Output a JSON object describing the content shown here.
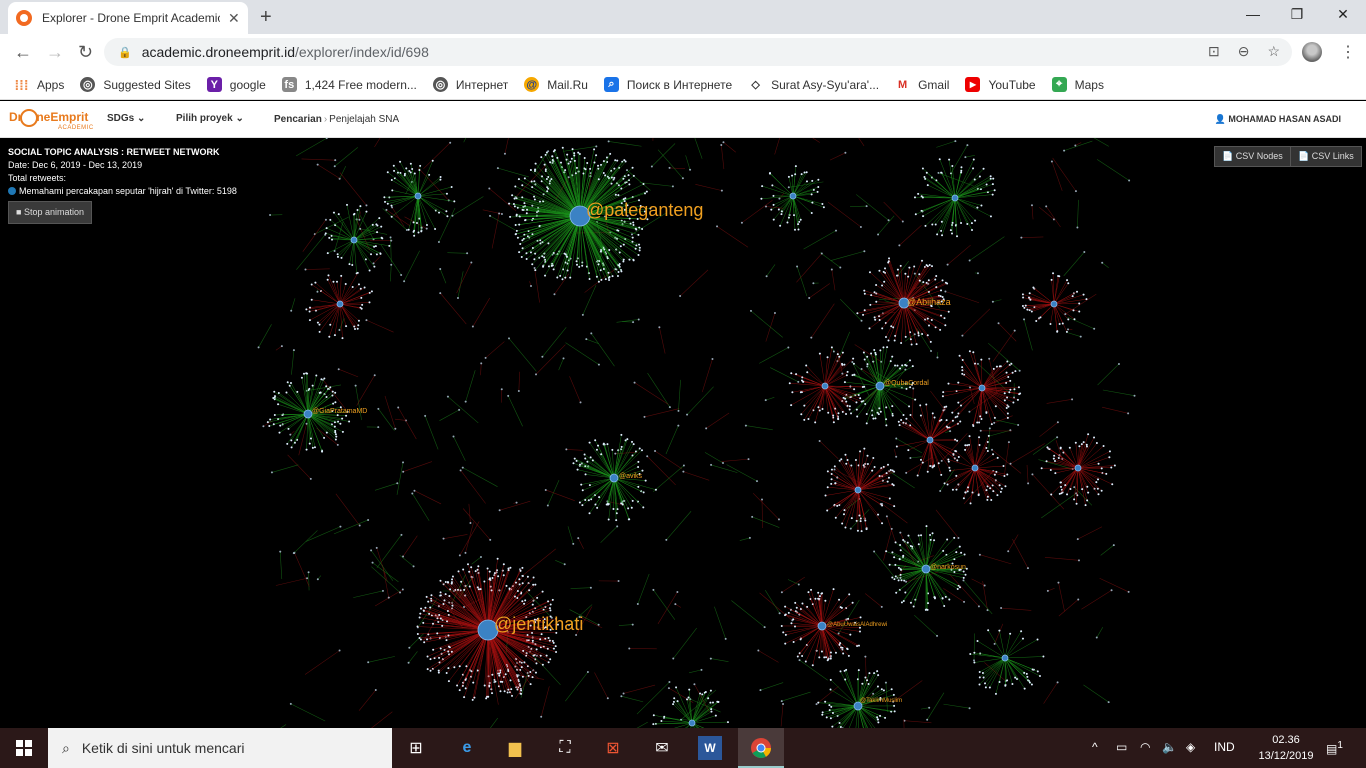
{
  "browser": {
    "tab_title": "Explorer - Drone Emprit Academic",
    "url_host": "academic.droneemprit.id",
    "url_path": "/explorer/index/id/698"
  },
  "bookmarks": [
    {
      "label": "Apps",
      "icon": "apps-grid-icon"
    },
    {
      "label": "Suggested Sites",
      "icon": "globe-icon"
    },
    {
      "label": "google",
      "icon": "yahoo-icon"
    },
    {
      "label": "1,424 Free modern...",
      "icon": "fs-icon"
    },
    {
      "label": "Интернет",
      "icon": "globe-icon"
    },
    {
      "label": "Mail.Ru",
      "icon": "mailru-icon"
    },
    {
      "label": "Поиск в Интернете",
      "icon": "search-icon"
    },
    {
      "label": "Surat Asy-Syu'ara'...",
      "icon": "globe-icon"
    },
    {
      "label": "Gmail",
      "icon": "gmail-icon"
    },
    {
      "label": "YouTube",
      "icon": "youtube-icon"
    },
    {
      "label": "Maps",
      "icon": "maps-icon"
    }
  ],
  "appnav": {
    "logo_text": "DroneEmprit",
    "logo_sub": "ACADEMIC",
    "menu_sdgs": "SDGs",
    "menu_project": "Pilih proyek",
    "crumb_parent": "Pencarian",
    "crumb_current": "Penjelajah SNA",
    "user": "MOHAMAD HASAN ASADI"
  },
  "viz": {
    "title": "SOCIAL TOPIC ANALYSIS : RETWEET NETWORK",
    "date": "Date: Dec 6, 2019 - Dec 13, 2019",
    "total_label": "Total retweets:",
    "legend_text": "Memahami percakapan seputar 'hijrah' di Twitter:",
    "legend_count": "5198",
    "stop_button": "Stop animation",
    "csv_nodes": "CSV Nodes",
    "csv_links": "CSV Links",
    "accounts": [
      "@paleganteng",
      "@jentikhati",
      "@Abiihaza",
      "@QubaCordal",
      "@GiaPratamaMD",
      "@aviks",
      "@narkosun",
      "@AbuUwaisAlAdhrewi",
      "@TaklimMuslim"
    ]
  },
  "taskbar": {
    "search_placeholder": "Ketik di sini untuk mencari",
    "lang": "IND",
    "time": "02.36",
    "date": "13/12/2019",
    "notif_count": "1"
  }
}
